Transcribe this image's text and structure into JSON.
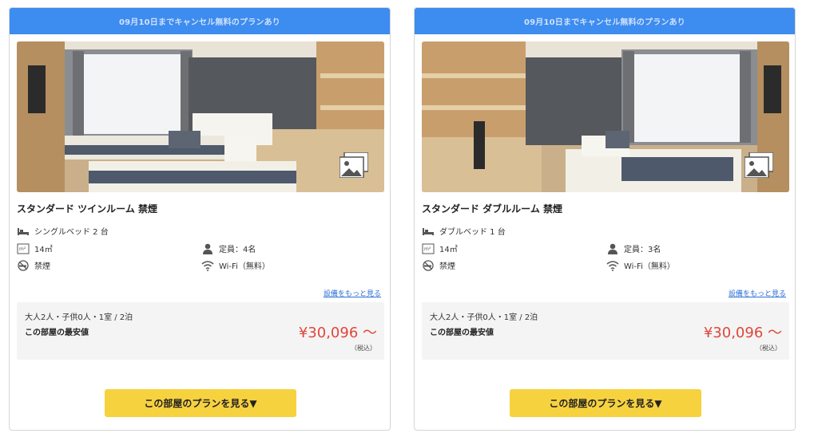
{
  "rooms": [
    {
      "banner": "09月10日までキャンセル無料のプランあり",
      "title": "スタンダード ツインルーム 禁煙",
      "bed": "シングルベッド 2 台",
      "area": "14㎡",
      "capacity": "定員：4名",
      "smoking": "禁煙",
      "wifi": "Wi-Fi（無料）",
      "more_link": "設備をもっと見る",
      "conditions": "大人2人・子供0人・1室 / 2泊",
      "lowest_label": "この部屋の最安値",
      "price": "¥30,096 〜",
      "tax": "（税込）",
      "plan_button": "この部屋のプランを見る▼"
    },
    {
      "banner": "09月10日までキャンセル無料のプランあり",
      "title": "スタンダード ダブルルーム 禁煙",
      "bed": "ダブルベッド 1 台",
      "area": "14㎡",
      "capacity": "定員：3名",
      "smoking": "禁煙",
      "wifi": "Wi-Fi（無料）",
      "more_link": "設備をもっと見る",
      "conditions": "大人2人・子供0人・1室 / 2泊",
      "lowest_label": "この部屋の最安値",
      "price": "¥30,096 〜",
      "tax": "（税込）",
      "plan_button": "この部屋のプランを見る▼"
    }
  ],
  "colors": {
    "banner": "#3d8cf0",
    "price": "#e0463b",
    "plan_button": "#f7d23f",
    "link": "#2b6fd6"
  },
  "icons": [
    "bed-icon",
    "area-icon",
    "person-icon",
    "no-smoking-icon",
    "wifi-icon",
    "gallery-icon"
  ]
}
